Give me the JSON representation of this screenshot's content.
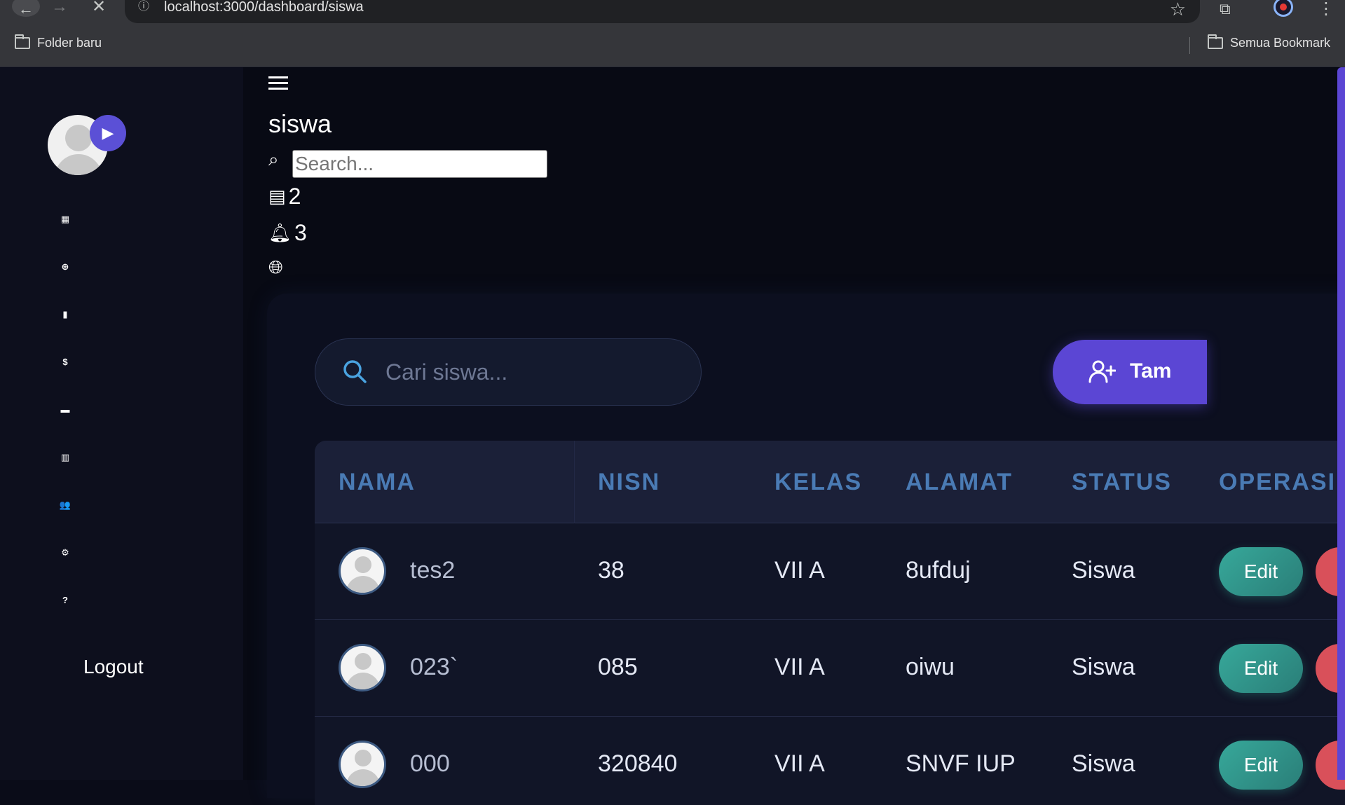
{
  "browser": {
    "url": "localhost:3000/dashboard/siswa",
    "bookmarks_left": "Folder baru",
    "bookmarks_right": "Semua Bookmark"
  },
  "sidebar": {
    "nav_icons": [
      "dashboard-icon",
      "globe-icon",
      "bag-icon",
      "dollar-icon",
      "briefcase-icon",
      "report-icon",
      "users-icon",
      "settings-icon",
      "help-icon"
    ],
    "nav_glyphs": [
      "▦",
      "⊕",
      "▮",
      "$",
      "▬",
      "▥",
      "👥",
      "⚙",
      "?"
    ],
    "logout_label": "Logout"
  },
  "topbar": {
    "page_title": "siswa",
    "search_placeholder": "Search...",
    "messages_count": "2",
    "notifications_count": "3"
  },
  "content": {
    "search_placeholder": "Cari siswa...",
    "add_button_label": "Tam",
    "accent_color": "#5b46d4",
    "edit_color": "#37a89a",
    "delete_color": "#d9505a"
  },
  "table": {
    "headers": {
      "nama": "NAMA",
      "nisn": "NISN",
      "kelas": "KELAS",
      "alamat": "ALAMAT",
      "status": "STATUS",
      "operasi": "OPERASI"
    },
    "rows": [
      {
        "nama": "tes2",
        "nisn": "38",
        "kelas": "VII A",
        "alamat": "8ufduj",
        "status": "Siswa",
        "edit": "Edit"
      },
      {
        "nama": "023`",
        "nisn": "085",
        "kelas": "VII A",
        "alamat": "oiwu",
        "status": "Siswa",
        "edit": "Edit"
      },
      {
        "nama": "000",
        "nisn": "320840",
        "kelas": "VII A",
        "alamat": "SNVF IUP",
        "status": "Siswa",
        "edit": "Edit"
      }
    ]
  }
}
